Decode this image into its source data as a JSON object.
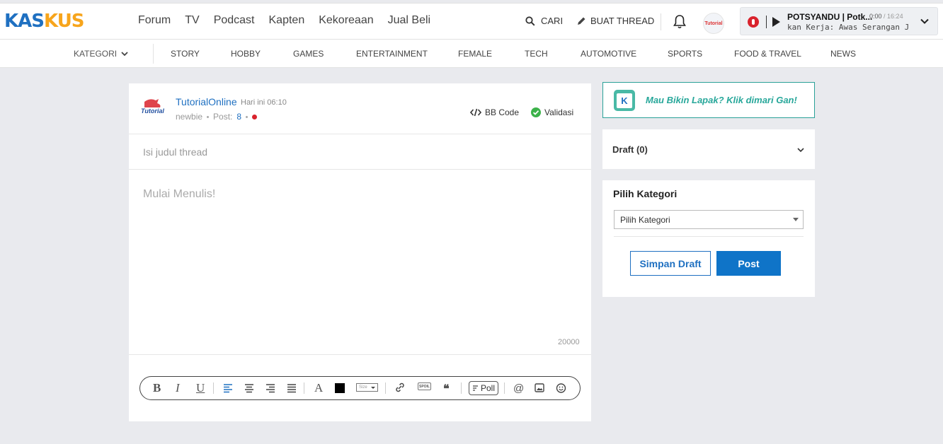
{
  "header": {
    "logo_text_a": "KAS",
    "logo_text_b": "KUS",
    "nav": [
      "Forum",
      "TV",
      "Podcast",
      "Kapten",
      "Kekoreaan",
      "Jual Beli"
    ],
    "search_label": "CARI",
    "create_thread_label": "BUAT THREAD",
    "user_avatar_label": "Tutorial",
    "player": {
      "title": "POTSYANDU | Potk...",
      "current_time": "0:00",
      "total_time": "/ 16:24",
      "subtitle": "kan Kerja: Awas Serangan Jant"
    }
  },
  "category_bar": {
    "kategori_label": "KATEGORI",
    "items": [
      "STORY",
      "HOBBY",
      "GAMES",
      "ENTERTAINMENT",
      "FEMALE",
      "TECH",
      "AUTOMOTIVE",
      "SPORTS",
      "FOOD & TRAVEL",
      "NEWS"
    ]
  },
  "editor": {
    "avatar_label": "Tutorial",
    "username": "TutorialOnline",
    "timestamp": "Hari ini 06:10",
    "rank": "newbie",
    "post_label": "Post:",
    "post_count": "8",
    "bbcode_label": "BB Code",
    "validasi_label": "Validasi",
    "title_placeholder": "Isi judul thread",
    "body_placeholder": "Mulai Menulis!",
    "char_limit": "20000",
    "toolbar": {
      "bold": "B",
      "italic": "I",
      "underline": "U",
      "font": "A",
      "size": "Size",
      "spoiler": "SPOIL",
      "quote": "❝",
      "poll": "Poll",
      "mention": "@"
    }
  },
  "sidebar": {
    "lapak_text": "Mau Bikin Lapak? Klik dimari Gan!",
    "lapak_icon_letter": "K",
    "draft_label": "Draft (0)",
    "kategori_title": "Pilih Kategori",
    "kategori_selected": "Pilih Kategori",
    "save_draft_label": "Simpan Draft",
    "post_label": "Post"
  }
}
